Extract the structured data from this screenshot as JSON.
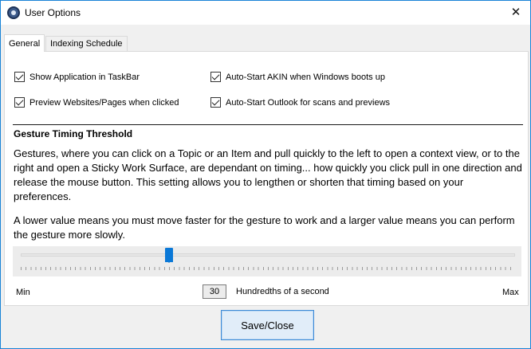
{
  "window": {
    "title": "User Options",
    "close_glyph": "✕"
  },
  "tabs": [
    {
      "label": "General",
      "active": true
    },
    {
      "label": "Indexing Schedule",
      "active": false
    }
  ],
  "options": [
    {
      "label": "Show Application in TaskBar",
      "checked": true
    },
    {
      "label": "Auto-Start AKIN when Windows boots up",
      "checked": true
    },
    {
      "label": "Preview Websites/Pages when clicked",
      "checked": true
    },
    {
      "label": "Auto-Start Outlook for scans and previews",
      "checked": true
    }
  ],
  "gesture": {
    "heading": "Gesture Timing Threshold",
    "para1": "Gestures, where you can click on a Topic or an Item and pull quickly to the left to open a context view, or to the right and open a Sticky Work Surface, are dependant on timing... how quickly you click pull in one direction and release the mouse button. This setting allows you to lengthen or shorten that timing based on your preferences.",
    "para2": "A lower value means you must move faster for the gesture to work and a larger value means you can perform the gesture more slowly."
  },
  "slider": {
    "min_label": "Min",
    "max_label": "Max",
    "value": "30",
    "unit_label": "Hundredths of a second",
    "position_fraction": 0.3
  },
  "actions": {
    "save_close": "Save/Close"
  },
  "colors": {
    "accent": "#0a78d7",
    "window_border": "#1883d7",
    "button_bg": "#e1edf9"
  }
}
